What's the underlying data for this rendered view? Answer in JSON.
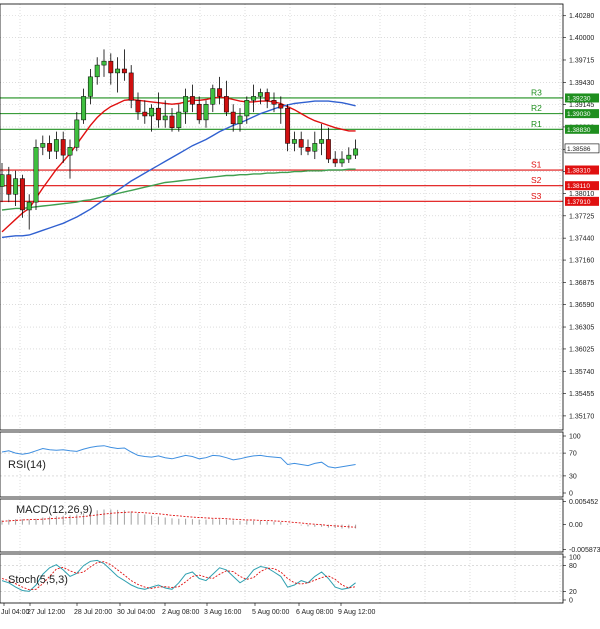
{
  "chart_data": {
    "type": "candlestick",
    "price_axis": {
      "ticks": [
        "1.40280",
        "1.40000",
        "1.39715",
        "1.39430",
        "1.39145",
        "1.38860",
        "1.38575",
        "1.38290",
        "1.38010",
        "1.37725",
        "1.37440",
        "1.37160",
        "1.36875",
        "1.36590",
        "1.36305",
        "1.36025",
        "1.35740",
        "1.35455",
        "1.35170"
      ],
      "ylim": [
        1.3499,
        1.4043
      ]
    },
    "current_price": "1.38586",
    "levels": [
      {
        "name": "R3",
        "label": "1.39230",
        "value": 1.3923,
        "color": "#1f8f1f"
      },
      {
        "name": "R2",
        "label": "1.39030",
        "value": 1.3903,
        "color": "#1f8f1f"
      },
      {
        "name": "R1",
        "label": "1.38830",
        "value": 1.3883,
        "color": "#1f8f1f"
      },
      {
        "name": "S1",
        "label": "1.38310",
        "value": 1.3831,
        "color": "#e01010"
      },
      {
        "name": "S2",
        "label": "1.38110",
        "value": 1.3811,
        "color": "#e01010"
      },
      {
        "name": "S3",
        "label": "1.37910",
        "value": 1.3791,
        "color": "#e01010"
      }
    ],
    "candles": [
      {
        "o": 1.381,
        "h": 1.384,
        "l": 1.379,
        "c": 1.3825
      },
      {
        "o": 1.3825,
        "h": 1.3835,
        "l": 1.379,
        "c": 1.38
      },
      {
        "o": 1.38,
        "h": 1.383,
        "l": 1.3785,
        "c": 1.382
      },
      {
        "o": 1.382,
        "h": 1.3825,
        "l": 1.377,
        "c": 1.378
      },
      {
        "o": 1.378,
        "h": 1.38,
        "l": 1.3755,
        "c": 1.379
      },
      {
        "o": 1.379,
        "h": 1.387,
        "l": 1.378,
        "c": 1.386
      },
      {
        "o": 1.386,
        "h": 1.3875,
        "l": 1.385,
        "c": 1.3865
      },
      {
        "o": 1.3865,
        "h": 1.3875,
        "l": 1.3845,
        "c": 1.3855
      },
      {
        "o": 1.3855,
        "h": 1.388,
        "l": 1.3845,
        "c": 1.387
      },
      {
        "o": 1.387,
        "h": 1.388,
        "l": 1.384,
        "c": 1.385
      },
      {
        "o": 1.385,
        "h": 1.387,
        "l": 1.382,
        "c": 1.386
      },
      {
        "o": 1.386,
        "h": 1.3905,
        "l": 1.3855,
        "c": 1.3895
      },
      {
        "o": 1.3895,
        "h": 1.3935,
        "l": 1.389,
        "c": 1.3925
      },
      {
        "o": 1.3925,
        "h": 1.396,
        "l": 1.3915,
        "c": 1.395
      },
      {
        "o": 1.395,
        "h": 1.3975,
        "l": 1.394,
        "c": 1.3965
      },
      {
        "o": 1.3965,
        "h": 1.3985,
        "l": 1.395,
        "c": 1.397
      },
      {
        "o": 1.397,
        "h": 1.398,
        "l": 1.394,
        "c": 1.3955
      },
      {
        "o": 1.3955,
        "h": 1.3975,
        "l": 1.393,
        "c": 1.396
      },
      {
        "o": 1.396,
        "h": 1.3985,
        "l": 1.3945,
        "c": 1.3955
      },
      {
        "o": 1.3955,
        "h": 1.3965,
        "l": 1.391,
        "c": 1.392
      },
      {
        "o": 1.392,
        "h": 1.393,
        "l": 1.3895,
        "c": 1.3905
      },
      {
        "o": 1.3905,
        "h": 1.392,
        "l": 1.389,
        "c": 1.39
      },
      {
        "o": 1.39,
        "h": 1.3915,
        "l": 1.388,
        "c": 1.391
      },
      {
        "o": 1.391,
        "h": 1.393,
        "l": 1.3885,
        "c": 1.3895
      },
      {
        "o": 1.3895,
        "h": 1.392,
        "l": 1.3885,
        "c": 1.39
      },
      {
        "o": 1.39,
        "h": 1.391,
        "l": 1.388,
        "c": 1.3885
      },
      {
        "o": 1.3885,
        "h": 1.3915,
        "l": 1.388,
        "c": 1.3905
      },
      {
        "o": 1.3905,
        "h": 1.3935,
        "l": 1.389,
        "c": 1.3925
      },
      {
        "o": 1.3925,
        "h": 1.394,
        "l": 1.3905,
        "c": 1.3915
      },
      {
        "o": 1.3915,
        "h": 1.3925,
        "l": 1.389,
        "c": 1.3895
      },
      {
        "o": 1.3895,
        "h": 1.392,
        "l": 1.3885,
        "c": 1.3915
      },
      {
        "o": 1.3915,
        "h": 1.394,
        "l": 1.3905,
        "c": 1.3935
      },
      {
        "o": 1.3935,
        "h": 1.395,
        "l": 1.3915,
        "c": 1.3925
      },
      {
        "o": 1.3925,
        "h": 1.3945,
        "l": 1.39,
        "c": 1.3905
      },
      {
        "o": 1.3905,
        "h": 1.3915,
        "l": 1.388,
        "c": 1.389
      },
      {
        "o": 1.389,
        "h": 1.391,
        "l": 1.388,
        "c": 1.39
      },
      {
        "o": 1.39,
        "h": 1.3925,
        "l": 1.389,
        "c": 1.392
      },
      {
        "o": 1.392,
        "h": 1.394,
        "l": 1.3905,
        "c": 1.3925
      },
      {
        "o": 1.3925,
        "h": 1.3935,
        "l": 1.3915,
        "c": 1.393
      },
      {
        "o": 1.393,
        "h": 1.3935,
        "l": 1.391,
        "c": 1.392
      },
      {
        "o": 1.392,
        "h": 1.393,
        "l": 1.3905,
        "c": 1.3915
      },
      {
        "o": 1.3915,
        "h": 1.3925,
        "l": 1.389,
        "c": 1.391
      },
      {
        "o": 1.391,
        "h": 1.3915,
        "l": 1.3855,
        "c": 1.3865
      },
      {
        "o": 1.3865,
        "h": 1.388,
        "l": 1.3855,
        "c": 1.387
      },
      {
        "o": 1.387,
        "h": 1.388,
        "l": 1.385,
        "c": 1.386
      },
      {
        "o": 1.386,
        "h": 1.387,
        "l": 1.385,
        "c": 1.3855
      },
      {
        "o": 1.3855,
        "h": 1.388,
        "l": 1.3845,
        "c": 1.3865
      },
      {
        "o": 1.3865,
        "h": 1.389,
        "l": 1.385,
        "c": 1.387
      },
      {
        "o": 1.387,
        "h": 1.3885,
        "l": 1.384,
        "c": 1.3845
      },
      {
        "o": 1.3845,
        "h": 1.3855,
        "l": 1.3835,
        "c": 1.384
      },
      {
        "o": 1.384,
        "h": 1.3855,
        "l": 1.3835,
        "c": 1.3845
      },
      {
        "o": 1.3845,
        "h": 1.386,
        "l": 1.384,
        "c": 1.385
      },
      {
        "o": 1.385,
        "h": 1.387,
        "l": 1.3845,
        "c": 1.3858
      }
    ],
    "moving_averages": [
      {
        "color": "#e01010",
        "values": [
          1.3752,
          1.376,
          1.3768,
          1.3776,
          1.3782,
          1.3795,
          1.3808,
          1.382,
          1.3832,
          1.3842,
          1.3852,
          1.3864,
          1.3876,
          1.3888,
          1.3898,
          1.3906,
          1.3912,
          1.3916,
          1.392,
          1.3921,
          1.392,
          1.3919,
          1.3918,
          1.3917,
          1.3916,
          1.3915,
          1.3916,
          1.3918,
          1.392,
          1.392,
          1.3921,
          1.3923,
          1.3924,
          1.3923,
          1.3921,
          1.3919,
          1.3918,
          1.3918,
          1.3919,
          1.3919,
          1.3918,
          1.3916,
          1.3912,
          1.3908,
          1.3903,
          1.3898,
          1.3894,
          1.3891,
          1.3888,
          1.3885,
          1.3883,
          1.3881,
          1.3881
        ]
      },
      {
        "color": "#3060d0",
        "values": [
          1.3745,
          1.3746,
          1.3747,
          1.3747,
          1.3748,
          1.3751,
          1.3754,
          1.3757,
          1.376,
          1.3763,
          1.3767,
          1.3771,
          1.3776,
          1.3781,
          1.3787,
          1.3793,
          1.3799,
          1.3805,
          1.3811,
          1.3817,
          1.3822,
          1.3827,
          1.3832,
          1.3837,
          1.3842,
          1.3847,
          1.3852,
          1.3857,
          1.3862,
          1.3866,
          1.387,
          1.3875,
          1.388,
          1.3884,
          1.3888,
          1.3891,
          1.3895,
          1.3899,
          1.3903,
          1.3906,
          1.3909,
          1.3912,
          1.3914,
          1.3916,
          1.3917,
          1.3918,
          1.3919,
          1.3919,
          1.3919,
          1.3918,
          1.3917,
          1.3915,
          1.3913
        ]
      },
      {
        "color": "#3f9f4f",
        "values": [
          1.378,
          1.3781,
          1.3782,
          1.3782,
          1.3783,
          1.3784,
          1.3785,
          1.3786,
          1.3787,
          1.3788,
          1.3789,
          1.379,
          1.3792,
          1.3793,
          1.3795,
          1.3797,
          1.3799,
          1.3801,
          1.3803,
          1.3805,
          1.3807,
          1.3809,
          1.3811,
          1.3813,
          1.3815,
          1.3816,
          1.3817,
          1.3818,
          1.3819,
          1.382,
          1.3821,
          1.3822,
          1.3823,
          1.3824,
          1.3824,
          1.3825,
          1.3825,
          1.3826,
          1.3826,
          1.3827,
          1.3827,
          1.3828,
          1.3828,
          1.3829,
          1.3829,
          1.383,
          1.383,
          1.383,
          1.3831,
          1.3831,
          1.3831,
          1.3832,
          1.3832
        ]
      }
    ],
    "x_ticks": [
      "Jul 04:00",
      "27 Jul 12:00",
      "28 Jul 20:00",
      "30 Jul 04:00",
      "2 Aug 08:00",
      "3 Aug 16:00",
      "5 Aug 00:00",
      "6 Aug 08:00",
      "9 Aug 12:00"
    ],
    "rsi": {
      "label": "RSI(14)",
      "ticks": [
        "100",
        "70",
        "30",
        "0"
      ],
      "ylim": [
        0,
        100
      ],
      "values": [
        72,
        74,
        70,
        68,
        70,
        74,
        78,
        76,
        75,
        76,
        74,
        73,
        77,
        80,
        82,
        83,
        80,
        78,
        79,
        72,
        66,
        64,
        63,
        65,
        62,
        60,
        63,
        66,
        64,
        60,
        62,
        66,
        65,
        62,
        58,
        60,
        63,
        65,
        66,
        64,
        63,
        62,
        50,
        52,
        50,
        48,
        52,
        54,
        46,
        44,
        46,
        48,
        50
      ]
    },
    "macd": {
      "label": "MACD(12,26,9)",
      "ticks": [
        "0.005452",
        "0.00",
        "-0.005873"
      ],
      "ylim": [
        -0.006,
        0.0056
      ],
      "histogram": [
        0.001,
        0.0012,
        0.0013,
        0.0013,
        0.0012,
        0.0014,
        0.0017,
        0.0019,
        0.002,
        0.0021,
        0.0022,
        0.0024,
        0.0027,
        0.0031,
        0.0034,
        0.0036,
        0.0036,
        0.0035,
        0.0034,
        0.0031,
        0.0027,
        0.0024,
        0.0021,
        0.0019,
        0.0017,
        0.0015,
        0.0014,
        0.0014,
        0.0013,
        0.0012,
        0.0012,
        0.0013,
        0.0013,
        0.0012,
        0.001,
        0.0009,
        0.0009,
        0.0009,
        0.0009,
        0.0008,
        0.0007,
        0.0006,
        0.0002,
        0.0,
        -0.0002,
        -0.0004,
        -0.0005,
        -0.0005,
        -0.0007,
        -0.0008,
        -0.0009,
        -0.0009,
        -0.0009
      ],
      "signal": [
        0.0008,
        0.0009,
        0.001,
        0.0011,
        0.0012,
        0.0012,
        0.0013,
        0.0014,
        0.0015,
        0.0016,
        0.0017,
        0.0018,
        0.0019,
        0.0021,
        0.0023,
        0.0025,
        0.0027,
        0.0028,
        0.0029,
        0.003,
        0.0029,
        0.0028,
        0.0027,
        0.0026,
        0.0024,
        0.0022,
        0.0021,
        0.0019,
        0.0018,
        0.0017,
        0.0016,
        0.0015,
        0.0015,
        0.0014,
        0.0013,
        0.0012,
        0.0011,
        0.0011,
        0.001,
        0.001,
        0.0009,
        0.0008,
        0.0007,
        0.0005,
        0.0004,
        0.0002,
        0.0001,
        0.0,
        -0.0002,
        -0.0003,
        -0.0004,
        -0.0005,
        -0.0006
      ]
    },
    "stoch": {
      "label": "Stoch(5,5,3)",
      "ticks": [
        "100",
        "80",
        "20",
        "0"
      ],
      "ylim": [
        0,
        100
      ],
      "main": [
        45,
        40,
        30,
        22,
        20,
        35,
        60,
        75,
        82,
        70,
        55,
        62,
        80,
        90,
        92,
        85,
        70,
        55,
        45,
        35,
        28,
        25,
        30,
        35,
        28,
        25,
        40,
        60,
        65,
        50,
        45,
        60,
        75,
        70,
        55,
        40,
        50,
        70,
        78,
        75,
        65,
        55,
        30,
        35,
        45,
        40,
        55,
        65,
        50,
        30,
        25,
        28,
        40
      ],
      "signal": [
        50,
        45,
        38,
        30,
        24,
        25,
        38,
        55,
        72,
        76,
        68,
        62,
        65,
        77,
        87,
        89,
        82,
        70,
        58,
        45,
        36,
        30,
        27,
        30,
        31,
        29,
        31,
        42,
        55,
        58,
        53,
        50,
        60,
        68,
        66,
        55,
        48,
        52,
        66,
        74,
        73,
        65,
        50,
        40,
        37,
        40,
        46,
        52,
        56,
        48,
        35,
        28,
        31
      ]
    }
  }
}
